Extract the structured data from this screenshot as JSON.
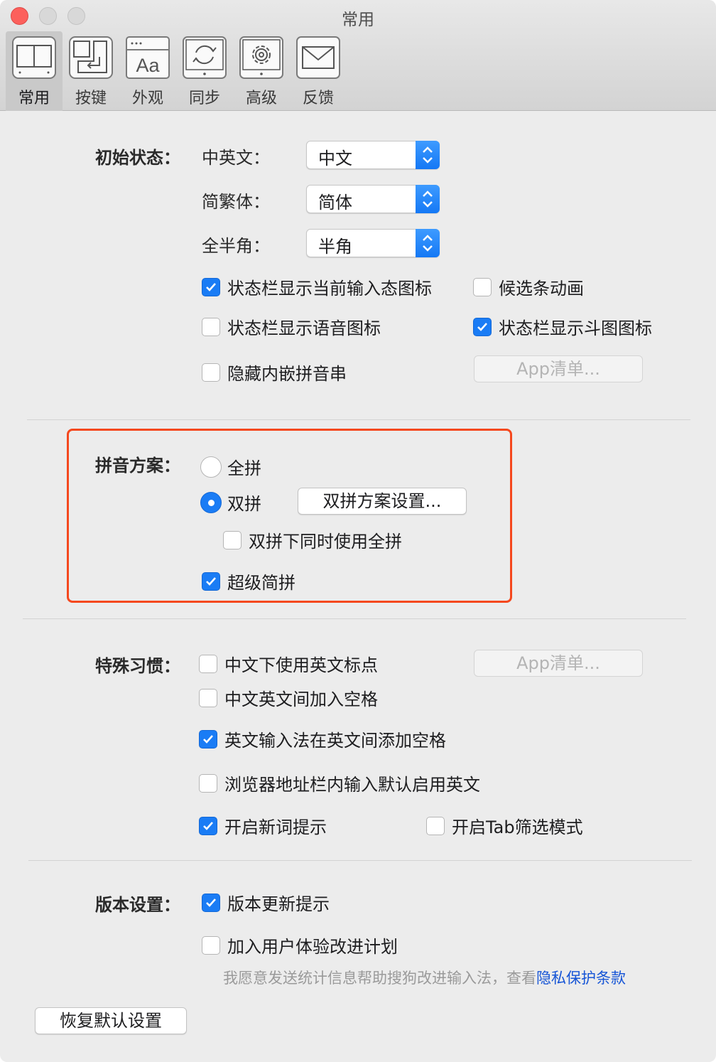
{
  "window": {
    "title": "常用"
  },
  "tabs": [
    {
      "label": "常用",
      "icon": "layout-icon",
      "active": true
    },
    {
      "label": "按键",
      "icon": "keyboard-return-icon",
      "active": false
    },
    {
      "label": "外观",
      "icon": "font-aa-icon",
      "active": false
    },
    {
      "label": "同步",
      "icon": "sync-icon",
      "active": false
    },
    {
      "label": "高级",
      "icon": "gear-icon",
      "active": false
    },
    {
      "label": "反馈",
      "icon": "envelope-icon",
      "active": false
    }
  ],
  "initial": {
    "section_label": "初始状态：",
    "zh_en_label": "中英文：",
    "zh_en_value": "中文",
    "simp_trad_label": "简繁体：",
    "simp_trad_value": "简体",
    "width_label": "全半角：",
    "width_value": "半角",
    "show_input_state_icon": {
      "label": "状态栏显示当前输入态图标",
      "checked": true
    },
    "candidate_animation": {
      "label": "候选条动画",
      "checked": false
    },
    "show_voice_icon": {
      "label": "状态栏显示语音图标",
      "checked": false
    },
    "show_doutu_icon": {
      "label": "状态栏显示斗图图标",
      "checked": true
    },
    "hide_inline_pinyin": {
      "label": "隐藏内嵌拼音串",
      "checked": false
    },
    "app_list_button": "App清单..."
  },
  "pinyin": {
    "section_label": "拼音方案：",
    "full": {
      "label": "全拼",
      "selected": false
    },
    "double": {
      "label": "双拼",
      "selected": true
    },
    "double_settings_button": "双拼方案设置...",
    "double_with_full": {
      "label": "双拼下同时使用全拼",
      "checked": false
    },
    "super_abbrev": {
      "label": "超级简拼",
      "checked": true
    }
  },
  "habits": {
    "section_label": "特殊习惯：",
    "en_punct_in_zh": {
      "label": "中文下使用英文标点",
      "checked": false
    },
    "app_list_button": "App清单...",
    "space_between_zh_en": {
      "label": "中文英文间加入空格",
      "checked": false
    },
    "en_ime_space": {
      "label": "英文输入法在英文间添加空格",
      "checked": true
    },
    "browser_addr_en": {
      "label": "浏览器地址栏内输入默认启用英文",
      "checked": false
    },
    "new_word_hint": {
      "label": "开启新词提示",
      "checked": true
    },
    "tab_filter": {
      "label": "开启Tab筛选模式",
      "checked": false
    }
  },
  "version": {
    "section_label": "版本设置：",
    "update_hint": {
      "label": "版本更新提示",
      "checked": true
    },
    "join_ux_plan": {
      "label": "加入用户体验改进计划",
      "checked": false
    },
    "note": "我愿意发送统计信息帮助搜狗改进输入法，查看",
    "privacy_link": "隐私保护条款"
  },
  "restore_button": "恢复默认设置"
}
